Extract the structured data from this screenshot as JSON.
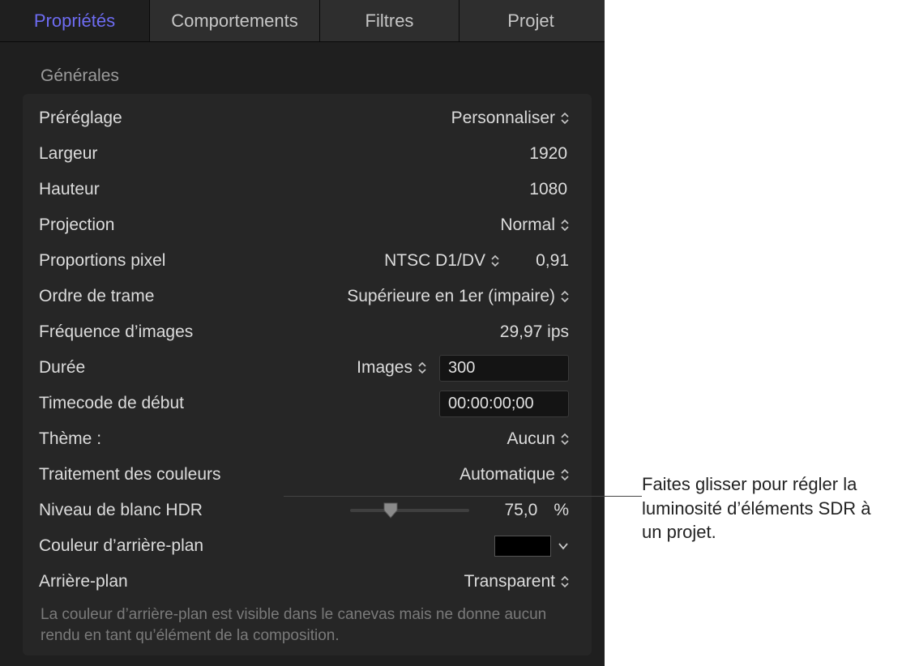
{
  "tabs": {
    "proprietes": "Propriétés",
    "comportements": "Comportements",
    "filtres": "Filtres",
    "projet": "Projet"
  },
  "section": "Générales",
  "rows": {
    "preset_label": "Préréglage",
    "preset_value": "Personnaliser",
    "width_label": "Largeur",
    "width_value": "1920",
    "height_label": "Hauteur",
    "height_value": "1080",
    "projection_label": "Projection",
    "projection_value": "Normal",
    "pixel_aspect_label": "Proportions pixel",
    "pixel_aspect_value": "NTSC D1/DV",
    "pixel_aspect_num": "0,91",
    "field_order_label": "Ordre de trame",
    "field_order_value": "Supérieure en 1er (impaire)",
    "fps_label": "Fréquence d’images",
    "fps_value": "29,97 ips",
    "duration_label": "Durée",
    "duration_unit": "Images",
    "duration_value": "300",
    "start_tc_label": "Timecode de début",
    "start_tc_value": "00:00:00;00",
    "theme_label": "Thème :",
    "theme_value": "Aucun",
    "color_proc_label": "Traitement des couleurs",
    "color_proc_value": "Automatique",
    "hdr_label": "Niveau de blanc HDR",
    "hdr_value": "75,0",
    "hdr_unit": "%",
    "hdr_slider_pct": 28,
    "bgcolor_label": "Couleur d’arrière-plan",
    "bgcolor_value": "#000000",
    "background_label": "Arrière-plan",
    "background_value": "Transparent"
  },
  "footnote": "La couleur d’arrière-plan est visible dans le canevas mais ne donne aucun rendu en tant qu’élément de la composition.",
  "callout": "Faites glisser pour régler la luminosité d’éléments SDR à un projet."
}
